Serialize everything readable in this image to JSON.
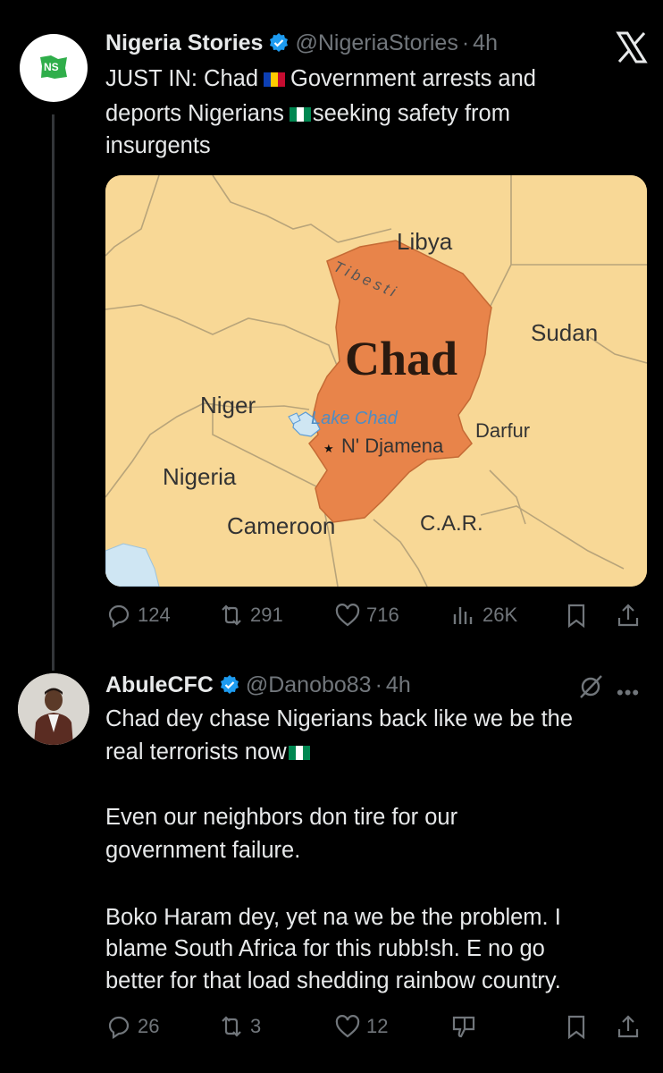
{
  "tweet1": {
    "author_name": "Nigeria Stories",
    "handle": "@NigeriaStories",
    "separator": "·",
    "time": "4h",
    "text_line1_a": "JUST IN: Chad",
    "text_line1_b": "Government arrests and",
    "text_line2_a": "deports Nigerians",
    "text_line2_b": "seeking safety from",
    "text_line3": "insurgents",
    "map": {
      "labels": {
        "libya": "Libya",
        "tibesti": "Tibesti",
        "chad": "Chad",
        "sudan": "Sudan",
        "niger": "Niger",
        "lake_chad": "Lake Chad",
        "capital": "N' Djamena",
        "darfur": "Darfur",
        "nigeria": "Nigeria",
        "cameroon": "Cameroon",
        "car": "C.A.R."
      }
    },
    "actions": {
      "replies": "124",
      "reposts": "291",
      "likes": "716",
      "views": "26K"
    }
  },
  "tweet2": {
    "author_name": "AbuleCFC",
    "handle": "@Danobo83",
    "separator": "·",
    "time": "4h",
    "p1_line1": "Chad dey chase Nigerians back like we be the",
    "p1_line2": "real terrorists now",
    "p2_line1": "Even our neighbors don tire for our",
    "p2_line2": "government failure.",
    "p3_line1": "Boko Haram dey, yet na we be the problem. I",
    "p3_line2": "blame South Africa for this rubb!sh. E no go",
    "p3_line3": "better for that load shedding rainbow country.",
    "actions": {
      "replies": "26",
      "reposts": "3",
      "likes": "12"
    }
  },
  "colors": {
    "background": "#000000",
    "text": "#e7e9ea",
    "muted": "#71767b",
    "verified": "#1d9bf0",
    "chad_fill": "#e8844a",
    "map_land": "#f8d896"
  },
  "icons": [
    "x-logo-icon",
    "verified-badge-icon",
    "chad-flag-icon",
    "nigeria-flag-icon",
    "reply-icon",
    "repost-icon",
    "like-icon",
    "views-icon",
    "bookmark-icon",
    "share-icon",
    "grok-icon",
    "more-icon",
    "downvote-icon"
  ]
}
